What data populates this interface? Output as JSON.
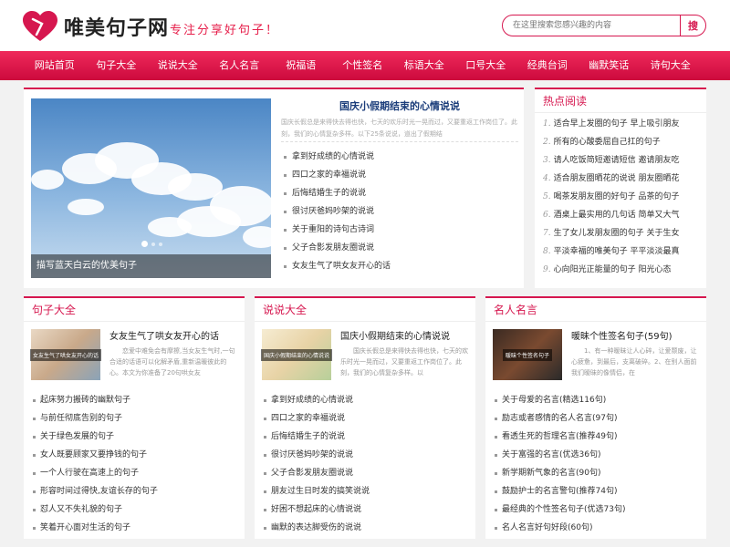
{
  "site": {
    "logo_text": "唯美句子网",
    "slogan": "专注分享好句子！"
  },
  "search": {
    "placeholder": "在这里搜索您感兴趣的内容",
    "button": "搜"
  },
  "nav": [
    "网站首页",
    "句子大全",
    "说说大全",
    "名人名言",
    "祝福语",
    "个性签名",
    "标语大全",
    "口号大全",
    "经典台词",
    "幽默笑话",
    "诗句大全"
  ],
  "banner": {
    "caption": "描写蓝天白云的优美句子",
    "feature_title": "国庆小假期结束的心情说说",
    "feature_desc": "国庆长假总是来得快去得也快，七天的欢乐时光一晃而过，又要重返工作岗位了。此刻，我们的心情复杂多样。以下25条说说，道出了假期结",
    "items": [
      "拿到好成绩的心情说说",
      "四口之家的幸福说说",
      "后悔结婚生子的说说",
      "很讨厌爸妈吵架的说说",
      "关于重阳的诗句古诗词",
      "父子合影发朋友圈说说",
      "女友生气了哄女友开心的话"
    ]
  },
  "hot": {
    "title": "热点阅读",
    "items": [
      {
        "num": "1.",
        "text": "适合早上发圈的句子 早上吸引朋友"
      },
      {
        "num": "2.",
        "text": "所有的心酸委屈自己扛的句子"
      },
      {
        "num": "3.",
        "text": "请人吃饭简短邀请短信 邀请朋友吃"
      },
      {
        "num": "4.",
        "text": "适合朋友圈晒花的说说 朋友圈晒花"
      },
      {
        "num": "5.",
        "text": "喝茶发朋友圈的好句子 品茶的句子"
      },
      {
        "num": "6.",
        "text": "酒桌上最实用的几句话 简单又大气"
      },
      {
        "num": "7.",
        "text": "生了女儿发朋友圈的句子 关于生女"
      },
      {
        "num": "8.",
        "text": "平淡幸福的唯美句子 平平淡淡最真"
      },
      {
        "num": "9.",
        "text": "心向阳光正能量的句子 阳光心态"
      }
    ]
  },
  "columns": [
    {
      "title": "句子大全",
      "thumb_label": "女友生气了哄女友开心的话",
      "thumb_title": "女友生气了哄女友开心的话",
      "thumb_desc": "恋爱中难免会有摩擦,当女友生气时,一句合适的话语可以化解矛盾,重新温暖彼此的心。本文为你准备了20句哄女友",
      "items": [
        "起床努力搬砖的幽默句子",
        "与前任彻底告别的句子",
        "关于绿色发展的句子",
        "女人既要顾家又要挣钱的句子",
        "一个人行驶在高速上的句子",
        "形容时间过得快,友谊长存的句子",
        "怼人又不失礼貌的句子",
        "笑着开心面对生活的句子"
      ]
    },
    {
      "title": "说说大全",
      "thumb_label": "国庆小假期结束的心情说说",
      "thumb_title": "国庆小假期结束的心情说说",
      "thumb_desc": "国庆长假总是来得快去得也快，七天的欢乐时光一晃而过，又要重返工作岗位了。此刻，我们的心情复杂多样。以",
      "items": [
        "拿到好成绩的心情说说",
        "四口之家的幸福说说",
        "后悔结婚生子的说说",
        "很讨厌爸妈吵架的说说",
        "父子合影发朋友圈说说",
        "朋友过生日时发的搞笑说说",
        "好困不想起床的心情说说",
        "幽默的表达脚受伤的说说"
      ]
    },
    {
      "title": "名人名言",
      "thumb_label": "暖昧个性签名句子",
      "thumb_title": "暖昧个性签名句子(59句)",
      "thumb_desc": "1、有一种暧昧让人心碎，让爱颓废，让心疲惫，到最后，支离破碎。2、在别人面前我们暧昧的像情侣，在",
      "items": [
        "关于母爱的名言(精选116句)",
        "励志或者感情的名人名言(97句)",
        "看透生死的哲理名言(推荐49句)",
        "关于富强的名言(优选36句)",
        "新学期新气象的名言(90句)",
        "鼓励护士的名言警句(推荐74句)",
        "最经典的个性签名句子(优选73句)",
        "名人名言好句好段(60句)"
      ]
    }
  ]
}
